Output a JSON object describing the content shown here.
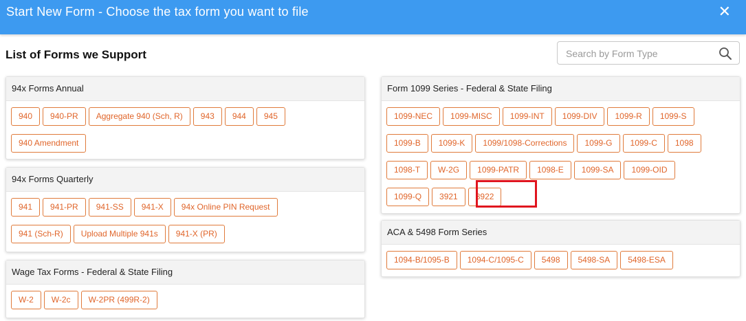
{
  "header": {
    "title": "Start New Form - Choose the tax form you want to file",
    "close_glyph": "✕"
  },
  "list_heading": "List of Forms we Support",
  "search": {
    "placeholder": "Search by Form Type",
    "icon": "search-icon"
  },
  "colors": {
    "topbar": "#3d9af0",
    "button_border": "#e07a3a",
    "button_text": "#e0652a",
    "highlight": "#e0141e"
  },
  "panels": {
    "annual": {
      "title": "94x Forms Annual",
      "rows": [
        [
          "940",
          "940-PR",
          "Aggregate 940 (Sch, R)",
          "943",
          "944",
          "945"
        ],
        [
          "940 Amendment"
        ]
      ]
    },
    "quarterly": {
      "title": "94x Forms Quarterly",
      "rows": [
        [
          "941",
          "941-PR",
          "941-SS",
          "941-X",
          "94x Online PIN Request"
        ],
        [
          "941 (Sch-R)",
          "Upload Multiple 941s",
          "941-X (PR)"
        ]
      ]
    },
    "wage": {
      "title": "Wage Tax Forms - Federal & State Filing",
      "rows": [
        [
          "W-2",
          "W-2c",
          "W-2PR (499R-2)"
        ]
      ]
    },
    "f1099": {
      "title": "Form 1099 Series - Federal & State Filing",
      "rows": [
        [
          "1099-NEC",
          "1099-MISC",
          "1099-INT",
          "1099-DIV",
          "1099-R",
          "1099-S"
        ],
        [
          "1099-B",
          "1099-K",
          "1099/1098-Corrections",
          "1099-G",
          "1099-C",
          "1098"
        ],
        [
          "1098-T",
          "W-2G",
          "1099-PATR",
          "1098-E",
          "1099-SA",
          "1099-OID"
        ],
        [
          "1099-Q",
          "3921",
          "3922"
        ]
      ]
    },
    "aca": {
      "title": "ACA & 5498 Form Series",
      "rows": [
        [
          "1094-B/1095-B",
          "1094-C/1095-C",
          "5498",
          "5498-SA",
          "5498-ESA"
        ]
      ]
    }
  }
}
